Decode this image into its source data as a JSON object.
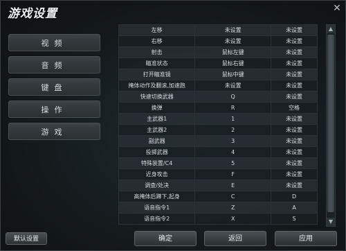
{
  "window": {
    "title": "游戏设置",
    "close_label": "✕"
  },
  "sidebar": {
    "items": [
      {
        "label": "视频"
      },
      {
        "label": "音频"
      },
      {
        "label": "键盘"
      },
      {
        "label": "操作"
      },
      {
        "label": "游戏"
      }
    ]
  },
  "keybinds": {
    "rows": [
      {
        "action": "左移",
        "primary": "未设置",
        "secondary": "未设置"
      },
      {
        "action": "右移",
        "primary": "未设置",
        "secondary": "未设置"
      },
      {
        "action": "射击",
        "primary": "鼠标左键",
        "secondary": "未设置"
      },
      {
        "action": "瞄准状态",
        "primary": "鼠标右键",
        "secondary": "未设置"
      },
      {
        "action": "打开瞄准镜",
        "primary": "鼠标中键",
        "secondary": "未设置"
      },
      {
        "action": "掩体动作及翻滚,加速跑",
        "primary": "未设置",
        "secondary": "未设置"
      },
      {
        "action": "快速切换武器",
        "primary": "Q",
        "secondary": "未设置"
      },
      {
        "action": "换弹",
        "primary": "R",
        "secondary": "空格"
      },
      {
        "action": "主武器1",
        "primary": "1",
        "secondary": "未设置"
      },
      {
        "action": "主武器2",
        "primary": "2",
        "secondary": "未设置"
      },
      {
        "action": "副武器",
        "primary": "3",
        "secondary": "未设置"
      },
      {
        "action": "投掷武器",
        "primary": "4",
        "secondary": "未设置"
      },
      {
        "action": "特殊装置/C4",
        "primary": "5",
        "secondary": "未设置"
      },
      {
        "action": "近身攻击",
        "primary": "F",
        "secondary": "未设置"
      },
      {
        "action": "调查/处决",
        "primary": "E",
        "secondary": "未设置"
      },
      {
        "action": "高掩体后蹲下,起身",
        "primary": "C",
        "secondary": "D"
      },
      {
        "action": "语音指令1",
        "primary": "Z",
        "secondary": "A"
      },
      {
        "action": "语音指令2",
        "primary": "X",
        "secondary": "S"
      }
    ]
  },
  "scrollbar": {
    "up_glyph": "▲",
    "down_glyph": "▼"
  },
  "buttons": {
    "default_label": "默认设置",
    "ok_label": "确定",
    "back_label": "返回",
    "apply_label": "应用"
  }
}
